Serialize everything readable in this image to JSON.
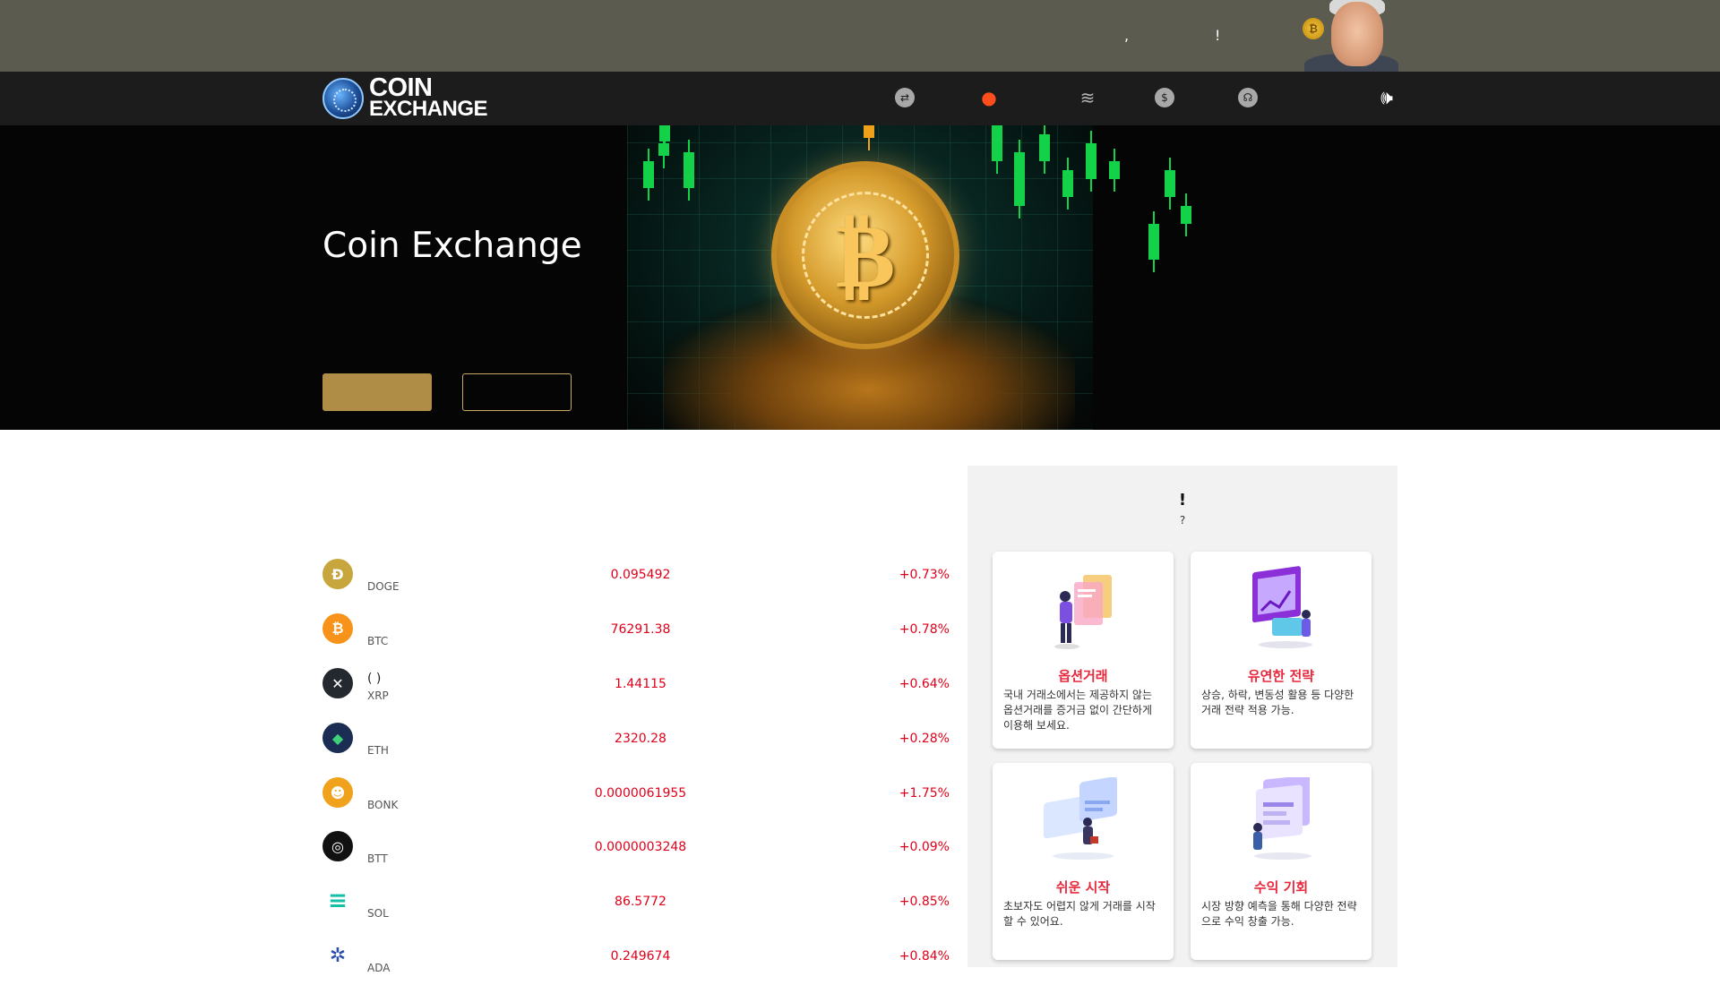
{
  "promo": {
    "text_comma": ",",
    "text_exclaim": "!",
    "coin_symbol": "₿"
  },
  "navbar": {
    "logo_line1": "COIN",
    "logo_line2": "EXCHANGE",
    "icons": [
      "exchange-icon",
      "fire-icon",
      "layers-icon",
      "dollar-icon",
      "support-icon",
      "sound-icon"
    ]
  },
  "hero": {
    "title": "Coin Exchange",
    "button1_label": "",
    "button2_label": ""
  },
  "coins": [
    {
      "name": "",
      "symbol": "DOGE",
      "price": "0.095492",
      "change": "+0.73%",
      "logo": "Ð",
      "color": "#c8a63e"
    },
    {
      "name": "",
      "symbol": "BTC",
      "price": "76291.38",
      "change": "+0.78%",
      "logo": "₿",
      "color": "#f7931a"
    },
    {
      "name": "(   )",
      "symbol": "XRP",
      "price": "1.44115",
      "change": "+0.64%",
      "logo": "✕",
      "color": "#23292f"
    },
    {
      "name": "",
      "symbol": "ETH",
      "price": "2320.28",
      "change": "+0.28%",
      "logo": "◆",
      "color": "#1b2d52"
    },
    {
      "name": "",
      "symbol": "BONK",
      "price": "0.0000061955",
      "change": "+1.75%",
      "logo": "☻",
      "color": "#f0a21d"
    },
    {
      "name": "",
      "symbol": "BTT",
      "price": "0.0000003248",
      "change": "+0.09%",
      "logo": "◎",
      "color": "#111111"
    },
    {
      "name": "",
      "symbol": "SOL",
      "price": "86.5772",
      "change": "+0.85%",
      "logo": "≡",
      "color": "#ffffff"
    },
    {
      "name": "",
      "symbol": "ADA",
      "price": "0.249674",
      "change": "+0.84%",
      "logo": "✲",
      "color": "#ffffff"
    }
  ],
  "panel": {
    "heading": "!",
    "subheading": "?",
    "cards": [
      {
        "title": "옵션거래",
        "desc": "국내 거래소에서는 제공하지 않는 옵션거래를 증거금 없이 간단하게 이용해 보세요."
      },
      {
        "title": "유연한 전략",
        "desc": "상승, 하락, 변동성 활용 등 다양한 거래 전략 적용 가능."
      },
      {
        "title": "쉬운 시작",
        "desc": "초보자도 어렵지 않게 거래를 시작할 수 있어요."
      },
      {
        "title": "수익 기회",
        "desc": "시장 방향 예측을 통해 다양한 전략으로 수익 창출 가능."
      }
    ]
  },
  "colors": {
    "promo_bg": "#5b5b4f",
    "navbar_bg": "#1c1c1c",
    "price_red": "#e0001a",
    "accent_gold": "#b08d46",
    "card_title_red": "#e8283c"
  }
}
